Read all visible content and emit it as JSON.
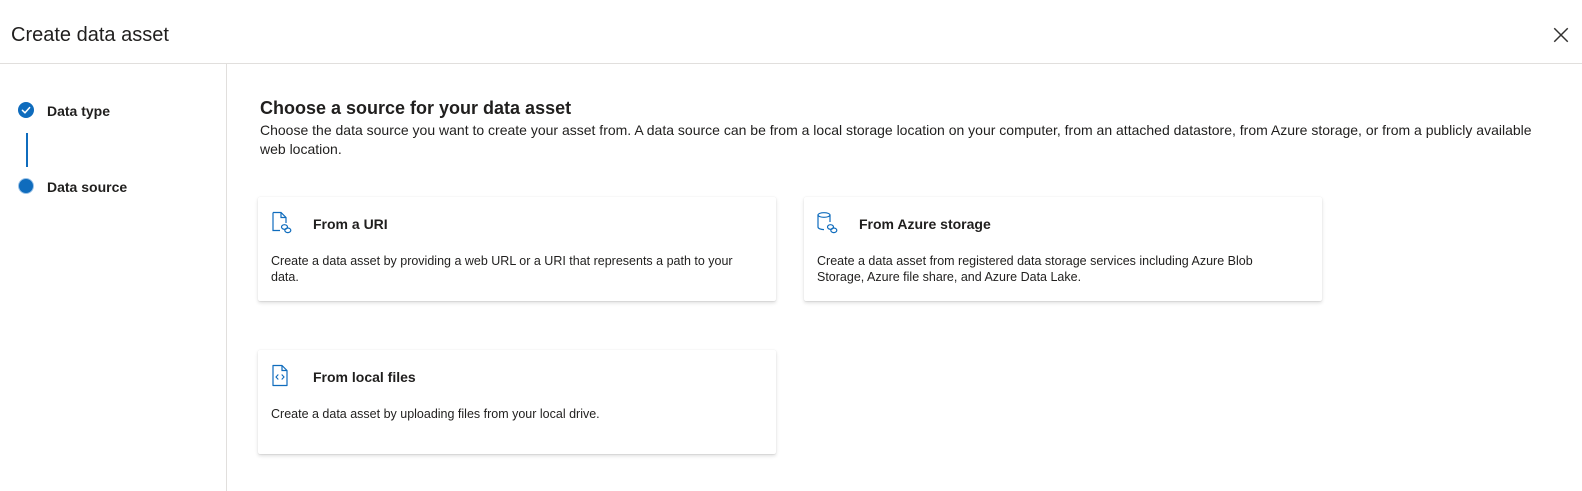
{
  "panel": {
    "title": "Create data asset",
    "close_icon": "close-icon"
  },
  "wizard": {
    "steps": [
      {
        "label": "Data type",
        "state": "completed",
        "icon": "checkmark-circle-icon"
      },
      {
        "label": "Data source",
        "state": "current",
        "icon": "filled-circle-icon"
      }
    ]
  },
  "main": {
    "title": "Choose a source for your data asset",
    "description": "Choose the data source you want to create your asset from. A data source can be from a local storage location on your computer, from an attached datastore, from Azure storage, or from a publicly available web location.",
    "options": [
      {
        "title": "From a URI",
        "description": "Create a data asset by providing a web URL or a URI that represents a path to your data.",
        "icon": "document-link-icon"
      },
      {
        "title": "From Azure storage",
        "description": "Create a data asset from registered data storage services including Azure Blob Storage, Azure file share, and Azure Data Lake.",
        "icon": "database-link-icon"
      },
      {
        "title": "From local files",
        "description": "Create a data asset by uploading files from your local drive.",
        "icon": "code-file-icon"
      }
    ]
  },
  "colors": {
    "accent": "#0f6cbd",
    "text": "#201f1e",
    "divider": "#e1dfdd"
  }
}
